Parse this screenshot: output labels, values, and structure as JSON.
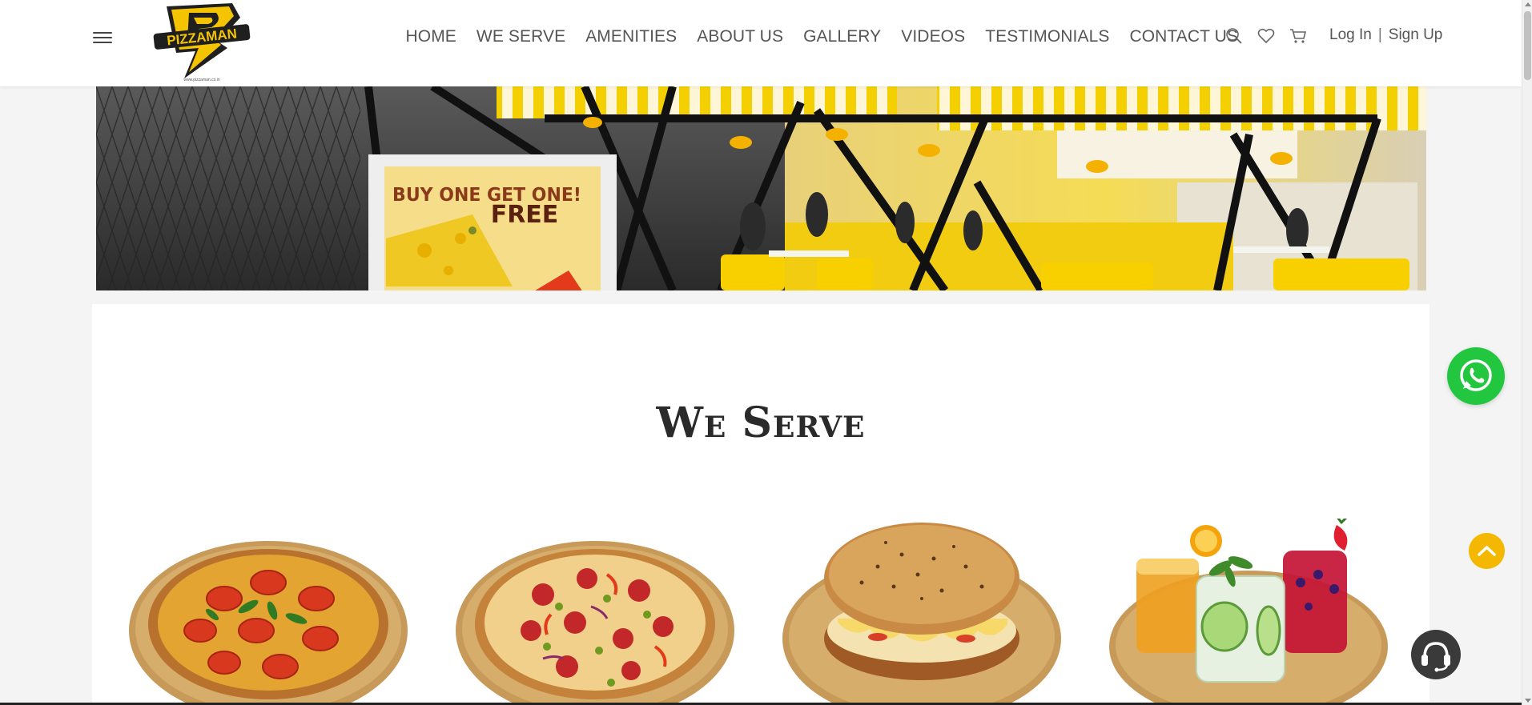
{
  "brand": {
    "logo_text": "PIZZAMAN",
    "logo_tagline": "www.pizzaman.co.in"
  },
  "nav": {
    "items": [
      {
        "label": "HOME"
      },
      {
        "label": "WE SERVE"
      },
      {
        "label": "AMENITIES"
      },
      {
        "label": "ABOUT US"
      },
      {
        "label": "GALLERY"
      },
      {
        "label": "VIDEOS"
      },
      {
        "label": "TESTIMONIALS"
      },
      {
        "label": "CONTACT US"
      }
    ]
  },
  "header_icons": [
    "search-icon",
    "heart-icon",
    "cart-icon",
    "menu-icon"
  ],
  "auth": {
    "login": "Log In",
    "separator": "|",
    "signup": "Sign Up"
  },
  "banner": {
    "sign_line1": "BUY ONE GET ONE!",
    "sign_line2": "FREE"
  },
  "section": {
    "title": "We Serve"
  },
  "serve_items": [
    {
      "icon": "margherita-pizza-image"
    },
    {
      "icon": "pepperoni-pizza-image"
    },
    {
      "icon": "stuffed-bread-image"
    },
    {
      "icon": "beverages-image"
    }
  ],
  "floating": [
    "whatsapp-icon",
    "chevron-up-icon",
    "headset-icon"
  ],
  "colors": {
    "accent": "#f5c400",
    "whatsapp": "#23c63f",
    "scroll_top": "#f5b800",
    "support": "#3a3a3a",
    "text": "#555555"
  }
}
